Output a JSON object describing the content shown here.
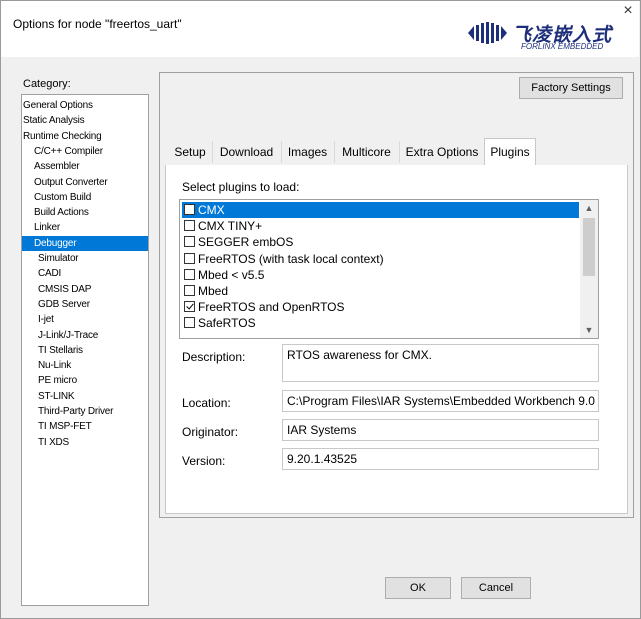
{
  "window": {
    "title": "Options for node \"freertos_uart\"",
    "close": "×"
  },
  "logo": {
    "cn": "飞凌嵌入式",
    "en": "FORLINX EMBEDDED"
  },
  "category": {
    "label": "Category:",
    "items": [
      {
        "label": "General Options",
        "indent": false
      },
      {
        "label": "Static Analysis",
        "indent": false
      },
      {
        "label": "Runtime Checking",
        "indent": false
      },
      {
        "label": "C/C++ Compiler",
        "indent": true
      },
      {
        "label": "Assembler",
        "indent": true
      },
      {
        "label": "Output Converter",
        "indent": true
      },
      {
        "label": "Custom Build",
        "indent": true
      },
      {
        "label": "Build Actions",
        "indent": true
      },
      {
        "label": "Linker",
        "indent": true
      },
      {
        "label": "Debugger",
        "indent": true,
        "selected": true
      },
      {
        "label": "Simulator",
        "indent": 2
      },
      {
        "label": "CADI",
        "indent": 2
      },
      {
        "label": "CMSIS DAP",
        "indent": 2
      },
      {
        "label": "GDB Server",
        "indent": 2
      },
      {
        "label": "I-jet",
        "indent": 2
      },
      {
        "label": "J-Link/J-Trace",
        "indent": 2
      },
      {
        "label": "TI Stellaris",
        "indent": 2
      },
      {
        "label": "Nu-Link",
        "indent": 2
      },
      {
        "label": "PE micro",
        "indent": 2
      },
      {
        "label": "ST-LINK",
        "indent": 2
      },
      {
        "label": "Third-Party Driver",
        "indent": 2
      },
      {
        "label": "TI MSP-FET",
        "indent": 2
      },
      {
        "label": "TI XDS",
        "indent": 2
      }
    ]
  },
  "factory_settings": "Factory Settings",
  "tabs": [
    "Setup",
    "Download",
    "Images",
    "Multicore",
    "Extra Options",
    "Plugins"
  ],
  "active_tab": "Plugins",
  "plugins": {
    "heading": "Select plugins to load:",
    "items": [
      {
        "label": "CMX",
        "checked": false,
        "selected": true
      },
      {
        "label": "CMX TINY+",
        "checked": false
      },
      {
        "label": "SEGGER embOS",
        "checked": false
      },
      {
        "label": "FreeRTOS (with task local context)",
        "checked": false
      },
      {
        "label": "Mbed < v5.5",
        "checked": false
      },
      {
        "label": "Mbed",
        "checked": false
      },
      {
        "label": "FreeRTOS and OpenRTOS",
        "checked": true
      },
      {
        "label": "SafeRTOS",
        "checked": false
      }
    ]
  },
  "details": {
    "description_label": "Description:",
    "description": "RTOS awareness for CMX.",
    "location_label": "Location:",
    "location": "C:\\Program Files\\IAR Systems\\Embedded Workbench 9.0",
    "originator_label": "Originator:",
    "originator": "IAR Systems",
    "version_label": "Version:",
    "version": "9.20.1.43525"
  },
  "buttons": {
    "ok": "OK",
    "cancel": "Cancel"
  },
  "colors": {
    "selection": "#0078d7",
    "logo": "#1d2f7a"
  }
}
